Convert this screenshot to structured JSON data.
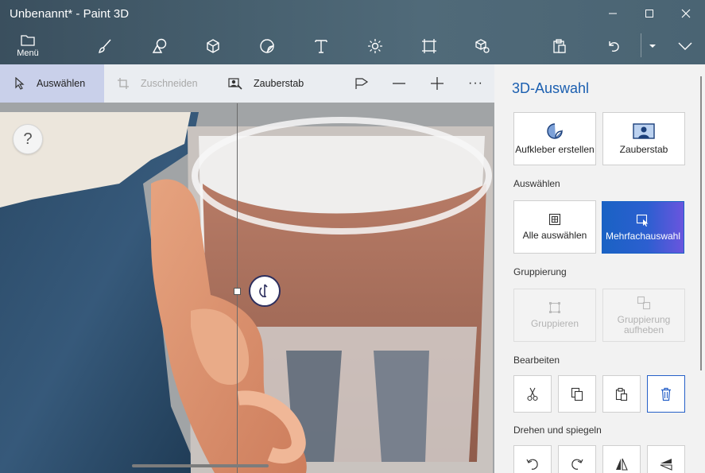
{
  "window": {
    "title": "Unbenannt* - Paint 3D",
    "minimize_glyph": "–",
    "maximize_glyph": "☐",
    "close_glyph": "✕"
  },
  "main_toolbar": {
    "menu_label": "Menü",
    "tools": [
      "brushes-icon",
      "2d-shapes-icon",
      "3d-shapes-icon",
      "stickers-icon",
      "text-icon",
      "effects-icon",
      "canvas-icon",
      "3d-library-icon"
    ],
    "right": [
      "paste-icon",
      "undo-icon",
      "history-dropdown-icon",
      "expand-icon"
    ]
  },
  "sub_toolbar": {
    "select_label": "Auswählen",
    "crop_label": "Zuschneiden",
    "magic_select_label": "Zauberstab",
    "more_glyph": "···"
  },
  "canvas": {
    "help_glyph": "?"
  },
  "panel": {
    "title": "3D-Auswahl",
    "top_cards": [
      {
        "label": "Aufkleber erstellen"
      },
      {
        "label": "Zauberstab"
      }
    ],
    "select_section": "Auswählen",
    "select_cards": [
      {
        "label": "Alle auswählen"
      },
      {
        "label": "Mehrfachauswahl"
      }
    ],
    "group_section": "Gruppierung",
    "group_cards": [
      {
        "label": "Gruppieren"
      },
      {
        "label": "Gruppierung aufheben"
      }
    ],
    "edit_section": "Bearbeiten",
    "edit_buttons": [
      "cut-icon",
      "copy-icon",
      "paste-icon",
      "delete-icon"
    ],
    "rotate_section": "Drehen und spiegeln",
    "rotate_buttons": [
      "rotate-left-icon",
      "rotate-right-icon",
      "flip-horizontal-icon",
      "flip-vertical-icon"
    ]
  },
  "colors": {
    "accent": "#1b5fb0",
    "active_card_start": "#1a62c4",
    "active_card_end": "#6a55de",
    "active_subtool": "#c9d0ea"
  }
}
